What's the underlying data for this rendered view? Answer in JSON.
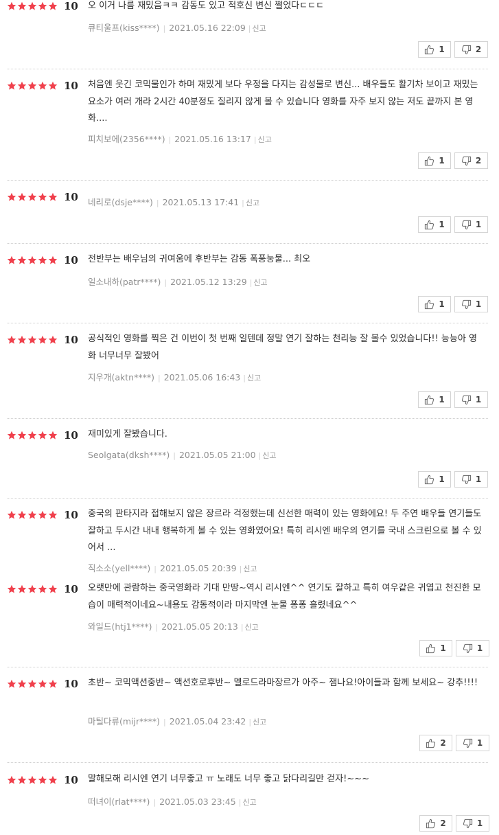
{
  "colors": {
    "star": "#f0404c",
    "meta": "#909090"
  },
  "icons": {
    "star": "star-icon",
    "up": "thumbs-up-icon",
    "down": "thumbs-down-icon"
  },
  "reviews": [
    {
      "rating": 5,
      "score": "10",
      "comment": "오 이거 나름 재밌음ㅋㅋ 감동도 있고 적호신 변신 쩔었다ㄷㄷㄷ",
      "user": "큐티울프(kiss****)",
      "date": "2021.05.16 22:09",
      "report": "신고",
      "likes": "1",
      "dislikes": "2"
    },
    {
      "rating": 5,
      "score": "10",
      "comment": "처음엔 웃긴 코믹물인가 하며 재밌게 보다 우정을 다지는 감성물로 변신... 배우들도 활기차 보이고 재밌는 요소가 여러 개라 2시간 40분정도 질리지 않게 볼 수 있습니다 영화를 자주 보지 않는 저도 끝까지 본 영화....",
      "user": "피치보에(2356****)",
      "date": "2021.05.16 13:17",
      "report": "신고",
      "likes": "1",
      "dislikes": "2"
    },
    {
      "rating": 5,
      "score": "10",
      "comment": "",
      "user": "네리로(dsje****)",
      "date": "2021.05.13 17:41",
      "report": "신고",
      "likes": "1",
      "dislikes": "1"
    },
    {
      "rating": 5,
      "score": "10",
      "comment": "전반부는 배우님의 귀여움에 후반부는 감동 폭풍눙물... 최오",
      "user": "일소내하(patr****)",
      "date": "2021.05.12 13:29",
      "report": "신고",
      "likes": "1",
      "dislikes": "1"
    },
    {
      "rating": 5,
      "score": "10",
      "comment": "공식적인 영화를 찍은 건 이번이 첫 번째 일텐데 정말 연기 잘하는 천리능 잘 볼수 있었습니다!! 능능아 영화 너무너무 잘봤어",
      "user": "지우개(aktn****)",
      "date": "2021.05.06 16:43",
      "report": "신고",
      "likes": "1",
      "dislikes": "1"
    },
    {
      "rating": 5,
      "score": "10",
      "comment": "재미있게 잘봤습니다.",
      "user": "Seolgata(dksh****)",
      "date": "2021.05.05 21:00",
      "report": "신고",
      "likes": "1",
      "dislikes": "1"
    },
    {
      "rating": 5,
      "score": "10",
      "comment": "중국의 판타지라 접해보지 않은 장르라 걱정했는데 신선한 매력이 있는 영화에요! 두 주연 배우들 연기들도 잘하고 두시간 내내 행복하게 볼 수 있는 영화였어요! 특히 리시엔 배우의 연기를 국내 스크린으로 볼 수 있어서 ...",
      "user": "직소소(yell****)",
      "date": "2021.05.05 20:39",
      "report": "신고"
    },
    {
      "rating": 5,
      "score": "10",
      "comment": "오랫만에 관람하는 중국영화라 기대 만땅~역시 리시엔^^ 연기도 잘하고 특히 여우같은 귀엽고 천진한 모습이 매력적이네요~내용도 감동적이라 마지막엔 눈물 퐁퐁 흘렸네요^^",
      "user": "와일드(htj1****)",
      "date": "2021.05.05 20:13",
      "report": "신고",
      "likes": "1",
      "dislikes": "1"
    },
    {
      "rating": 5,
      "score": "10",
      "comment": "초반~ 코믹액션중반~ 액션호로후반~ 멜로드라마장르가 아주~ 잼나요!아이들과 함께 보세요~ 강추!!!!",
      "user": "마틸다류(mijr****)",
      "date": "2021.05.04 23:42",
      "report": "신고",
      "likes": "2",
      "dislikes": "1"
    },
    {
      "rating": 5,
      "score": "10",
      "comment": "말해모해 리시엔 연기 너무좋고 ㅠ 노래도 너무 좋고 닭다리길만 걷자!~~~",
      "user": "떠녀이(rlat****)",
      "date": "2021.05.03 23:45",
      "report": "신고",
      "likes": "2",
      "dislikes": "1"
    }
  ]
}
